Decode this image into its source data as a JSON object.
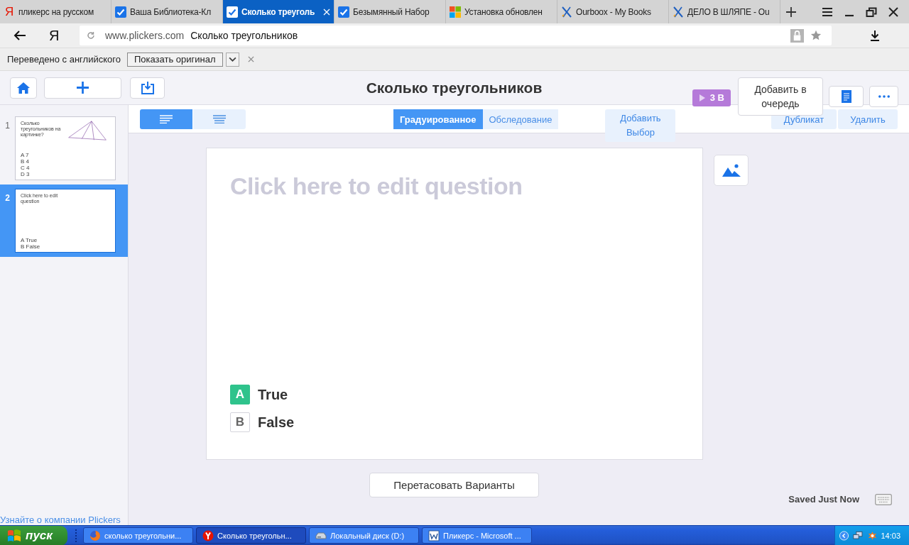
{
  "browser": {
    "tabs": [
      {
        "title": "пликерс на русском",
        "kind": "yandex",
        "icon_text": "Я",
        "selected": false
      },
      {
        "title": "Ваша Библиотека-Кл",
        "kind": "check",
        "selected": false
      },
      {
        "title": "Сколько треуголь",
        "kind": "check",
        "selected": true
      },
      {
        "title": "Безымянный Набор",
        "kind": "check",
        "selected": false
      },
      {
        "title": "Установка обновлен",
        "kind": "windows",
        "selected": false
      },
      {
        "title": "Ourboox - My Books",
        "kind": "ourboox",
        "selected": false
      },
      {
        "title": "ДЕЛО В ШЛЯПЕ - Ou",
        "kind": "ourboox",
        "selected": false
      }
    ],
    "logo": "Я",
    "url": "www.plickers.com",
    "page_title": "Сколько треугольников"
  },
  "translate_bar": {
    "message": "Переведено с английского",
    "button": "Показать оригинал"
  },
  "header": {
    "title": "Сколько треугольников",
    "badge": "3 В",
    "queue_button": "Добавить в очередь"
  },
  "toolbar": {
    "alignments": [
      {
        "selected": true
      },
      {
        "selected": false
      }
    ],
    "modes": [
      {
        "label": "Градуированное",
        "selected": true
      },
      {
        "label": "Обследование",
        "selected": false
      }
    ],
    "add_choice": "Добавить Выбор",
    "duplicate": "Дубликат",
    "delete": "Удалить"
  },
  "slides": [
    {
      "number": "1",
      "question": "Сколько треугольников на картинке?",
      "has_image": true,
      "selected": false,
      "choices": [
        {
          "letter": "A",
          "text": "7"
        },
        {
          "letter": "B",
          "text": "4"
        },
        {
          "letter": "C",
          "text": "4"
        },
        {
          "letter": "D",
          "text": "3"
        }
      ]
    },
    {
      "number": "2",
      "question": "Click here to edit question",
      "has_image": false,
      "selected": true,
      "choices": [
        {
          "letter": "A",
          "text": "True"
        },
        {
          "letter": "B",
          "text": "False"
        }
      ]
    }
  ],
  "sidebar_link": "Узнайте о компании Plickers",
  "question": {
    "placeholder": "Click here to edit question",
    "choices": [
      {
        "letter": "A",
        "text": "True",
        "correct": true
      },
      {
        "letter": "B",
        "text": "False",
        "correct": false
      }
    ]
  },
  "shuffle_button": "Перетасовать Варианты",
  "save_status": "Saved Just Now",
  "taskbar": {
    "start": "пуск",
    "tasks": [
      {
        "label": "сколько треугольни...",
        "kind": "firefox",
        "selected": false
      },
      {
        "label": "Сколько треугольн...",
        "kind": "yandex",
        "selected": true
      },
      {
        "label": "Локальный диск (D:)",
        "kind": "drive",
        "selected": false
      },
      {
        "label": "Пликерс - Microsoft ...",
        "kind": "word",
        "selected": false
      }
    ],
    "clock": "14:03"
  }
}
